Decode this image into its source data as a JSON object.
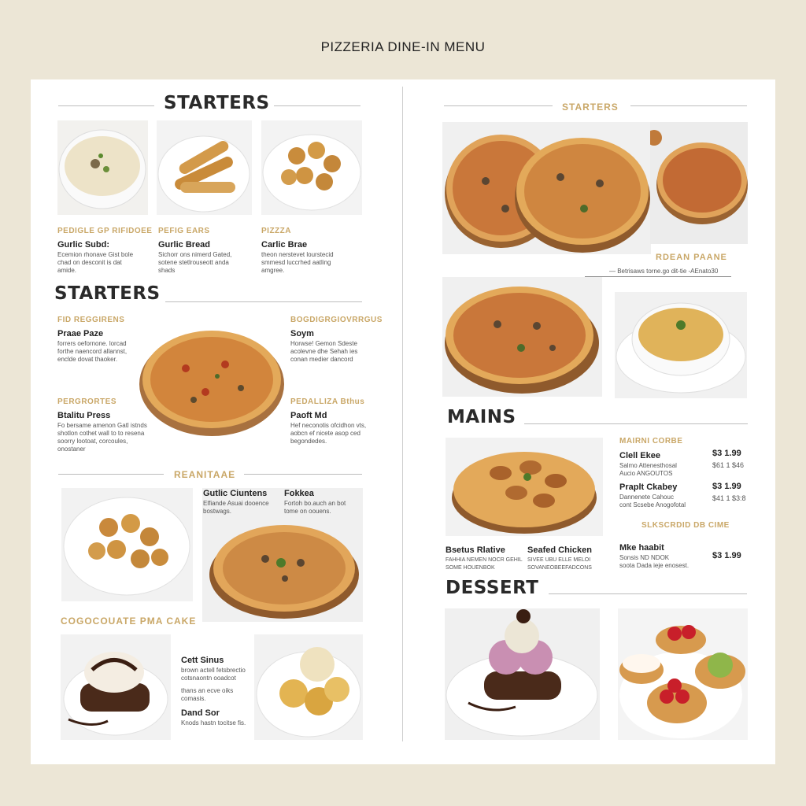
{
  "page_title": "PIZZERIA DINE-IN MENU",
  "left": {
    "starters_header": "STARTERS",
    "row1": [
      {
        "category": "PEDIGLE GP RIFIDOEE",
        "name": "Gurlic Subd:",
        "desc": [
          "Ecemion rhonave Gist bole",
          "chad on desconit is dat",
          "amide."
        ]
      },
      {
        "category": "PEFIG EARS",
        "name": "Gurlic Bread",
        "desc": [
          "Sichorr ons nimerd Gated,",
          "sotene stetlrouseott anda",
          "shads"
        ]
      },
      {
        "category": "PIZZZA",
        "name": "Carlic Brae",
        "desc": [
          "theon nerstevet lourstecid",
          "smmesd luccrhed aatling",
          "amgree."
        ]
      }
    ],
    "starters2_header": "STARTERS",
    "mid_items": [
      {
        "category": "FID REGGIRENS",
        "name": "Praae Paze",
        "desc": [
          "forrers oefornone. lorcad",
          "forthe naencord allannst,",
          "enclde dovat thaoker."
        ]
      },
      {
        "category": "BOGDIGRGIOVRRGUS",
        "name": "Soym",
        "desc": [
          "Horwse! Gemon Sdeste",
          "acolevne dhe Sehah ies",
          "conan medier dancord"
        ]
      },
      {
        "category": "PERGRORTES",
        "name": "Btalitu Press",
        "desc": [
          "Fo bersame amenon Gatl istnds",
          "shotlon cothet wall to to resena",
          "soorry lootoat, corcoules,",
          "onostaner"
        ]
      },
      {
        "category": "PEDALLIZA Bthus",
        "name": "Paoft Md",
        "desc": [
          "Hef neconotis ofcidhon vts,",
          "aobcn ef nicete asop ced",
          "begondedes."
        ]
      }
    ],
    "section3_label": "REANITAAE",
    "section3_items": [
      {
        "name": "Gutlic Ciuntens",
        "desc": [
          "Elfiande Asuai dooence",
          "bostwags."
        ]
      },
      {
        "name": "Fokkea",
        "desc": [
          "Fortoh bo.auch an bot",
          "tome on oouens."
        ]
      }
    ],
    "section4_label": "COGOCOUATE PMA CAKE",
    "dessert_items": [
      {
        "name": "Cett Sinus",
        "desc": [
          "brown actell fetsbrectio",
          "cotsnaontn ooadcot",
          "thans an ecve oiks",
          "comasis."
        ]
      },
      {
        "name": "Dand Sor",
        "desc": [
          "Knods hastn tocitse fis."
        ]
      }
    ]
  },
  "right": {
    "starters_label": "STARTERS",
    "caption_label": "RDEAN PAANE",
    "caption_text": "— Betrisaws torne.go dit-tie -AEnato30",
    "mains_header": "MAINS",
    "mains_label": "MAIRNI CORBE",
    "mains_items": [
      {
        "name": "Clell Ekee",
        "desc": [
          "Salmo Attenesthosal",
          "Aucio ANGOUTOS"
        ],
        "price": "$3 1.99",
        "price2": "$61 1 $46"
      },
      {
        "name": "Praplt Ckabey",
        "desc": [
          "Dannenete Cahouc",
          "cont Scsebe Anogofotal"
        ],
        "price": "$3 1.99",
        "price2": "$41 1 $3:8"
      }
    ],
    "mains_label2": "SLKSCRDID DB CIME",
    "bottom_items": [
      {
        "name": "Bsetus Rlative",
        "desc": [
          "FAHHIA NEMEN NOCR GEHIL",
          "SOME HOUENBOK"
        ]
      },
      {
        "name": "Seafed Chicken",
        "desc": [
          "SIVEE UBU ELLE MELOI",
          "SOVANEOBEEFADCONS"
        ]
      },
      {
        "name": "Mke haabit",
        "desc": [
          "Sonsis ND NDOK",
          "soota Dada ieje enosest."
        ],
        "price": "$3 1.99"
      }
    ],
    "dessert_header": "DESSERT"
  }
}
